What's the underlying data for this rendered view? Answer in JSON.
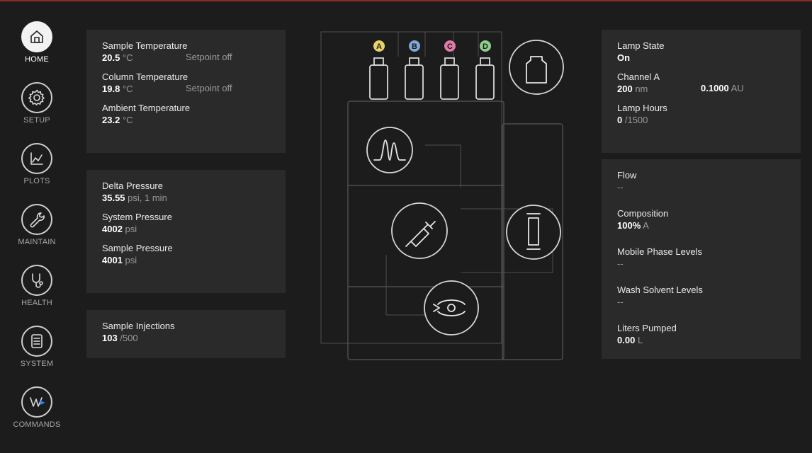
{
  "nav": [
    {
      "label": "HOME",
      "icon": "home-icon",
      "active": true
    },
    {
      "label": "SETUP",
      "icon": "gear-icon"
    },
    {
      "label": "PLOTS",
      "icon": "chart-icon"
    },
    {
      "label": "MAINTAIN",
      "icon": "wrench-icon"
    },
    {
      "label": "HEALTH",
      "icon": "stethoscope-icon"
    },
    {
      "label": "SYSTEM",
      "icon": "system-icon"
    },
    {
      "label": "COMMANDS",
      "icon": "commands-icon"
    }
  ],
  "temperature": {
    "sample_label": "Sample Temperature",
    "sample_value": "20.5",
    "sample_unit": "°C",
    "sample_setpoint": "Setpoint off",
    "column_label": "Column Temperature",
    "column_value": "19.8",
    "column_unit": "°C",
    "column_setpoint": "Setpoint off",
    "ambient_label": "Ambient Temperature",
    "ambient_value": "23.2",
    "ambient_unit": "°C"
  },
  "pressure": {
    "delta_label": "Delta Pressure",
    "delta_value": "35.55",
    "delta_unit": "psi, 1 min",
    "system_label": "System Pressure",
    "system_value": "4002",
    "system_unit": "psi",
    "sample_label": "Sample Pressure",
    "sample_value": "4001",
    "sample_unit": "psi"
  },
  "injections": {
    "label": "Sample Injections",
    "value": "103",
    "unit": "/500"
  },
  "lamp": {
    "state_label": "Lamp State",
    "state_value": "On",
    "channel_label": "Channel A",
    "wavelength_value": "200",
    "wavelength_unit": "nm",
    "absorbance_value": "0.1000",
    "absorbance_unit": "AU",
    "hours_label": "Lamp Hours",
    "hours_value": "0",
    "hours_unit": "/1500"
  },
  "flow": {
    "flow_label": "Flow",
    "flow_value": "--",
    "composition_label": "Composition",
    "composition_value": "100%",
    "composition_unit": "A",
    "mobile_label": "Mobile Phase Levels",
    "mobile_value": "--",
    "wash_label": "Wash Solvent Levels",
    "wash_value": "--",
    "liters_label": "Liters Pumped",
    "liters_value": "0.00",
    "liters_unit": "L"
  },
  "bottles": [
    {
      "letter": "A",
      "color": "#e8d36a"
    },
    {
      "letter": "B",
      "color": "#7fa9d9"
    },
    {
      "letter": "C",
      "color": "#e07aa8"
    },
    {
      "letter": "D",
      "color": "#8fce8a"
    }
  ],
  "colors": {
    "background": "#1c1c1c",
    "card": "#2a2a2a",
    "accent_line": "#8b2a2a"
  }
}
